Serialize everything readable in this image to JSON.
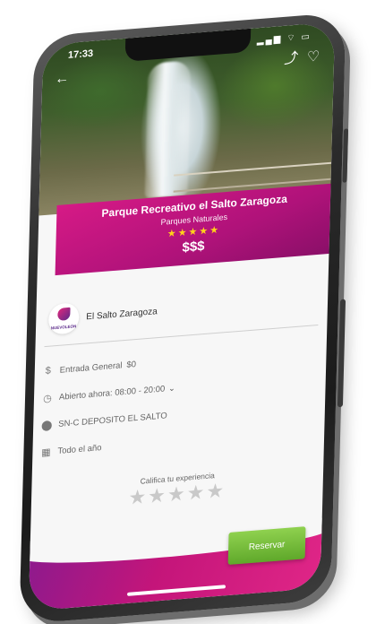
{
  "status": {
    "time": "17:33",
    "icons": "▂▄▆ ⌔ ▭"
  },
  "nav": {
    "back": "←",
    "share": "⤴",
    "favorite": "♡"
  },
  "place": {
    "name": "Parque Recreativo el Salto Zaragoza",
    "category": "Parques Naturales",
    "rating_stars": "★★★★★",
    "price_level": "$$$"
  },
  "organization": {
    "logo_text": "NUEVOLEÓN",
    "name": "El Salto Zaragoza"
  },
  "details": {
    "entrance_label": "Entrada General",
    "entrance_price": "$0",
    "hours": "Abierto ahora: 08:00 - 20:00",
    "address": "SN-C DEPOSITO EL SALTO",
    "season": "Todo el año"
  },
  "rating": {
    "label": "Califica tu experiencia",
    "empty_stars": "★★★★★"
  },
  "actions": {
    "reserve_label": "Reservar"
  },
  "colors": {
    "brand_magenta": "#d61a86",
    "reserve_green": "#7cc23e",
    "star_gold": "#ffd21a"
  }
}
